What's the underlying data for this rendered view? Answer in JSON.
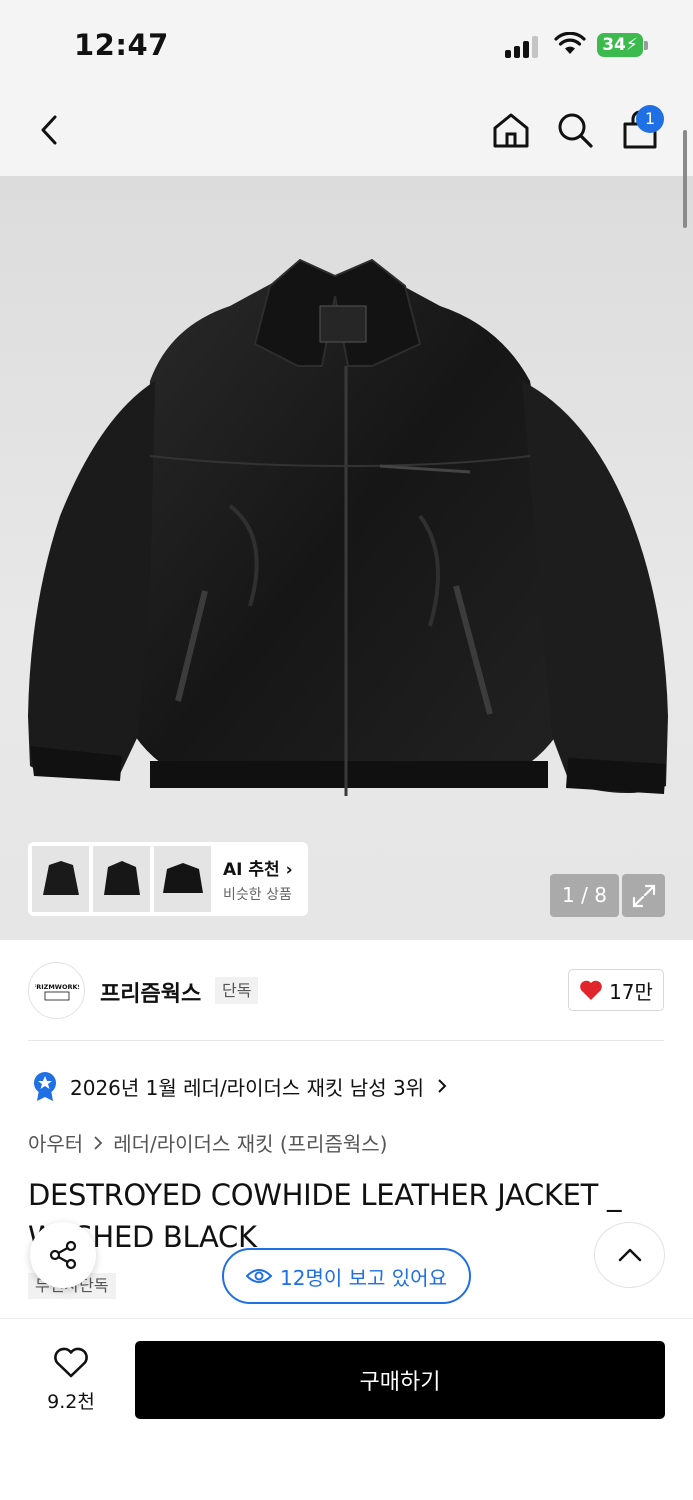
{
  "status": {
    "time": "12:47",
    "battery": "34"
  },
  "nav": {
    "cart_count": "1"
  },
  "gallery": {
    "ai_title": "AI 추천 ›",
    "ai_subtitle": "비슷한 상품",
    "page_counter": "1 / 8"
  },
  "brand": {
    "logo_text": "FRIZMWORKS",
    "name": "프리즘웍스",
    "badge": "단독",
    "like_count": "17만"
  },
  "ranking": {
    "text": "2026년 1월 레더/라이더스 재킷 남성 3위"
  },
  "breadcrumb": {
    "level1": "아우터",
    "level2": "레더/라이더스 재킷 (프리즘웍스)"
  },
  "product": {
    "title": "DESTROYED COWHIDE LEATHER JACKET _ WASHED BLACK",
    "badge": "무신사단독"
  },
  "viewers": {
    "text": "12명이 보고 있어요"
  },
  "bottom": {
    "wish_count": "9.2천",
    "buy_label": "구매하기"
  },
  "colors": {
    "accent": "#1f6fe5",
    "like_red": "#e0262b",
    "buy_bg": "#000000",
    "battery": "#3dba4e"
  }
}
